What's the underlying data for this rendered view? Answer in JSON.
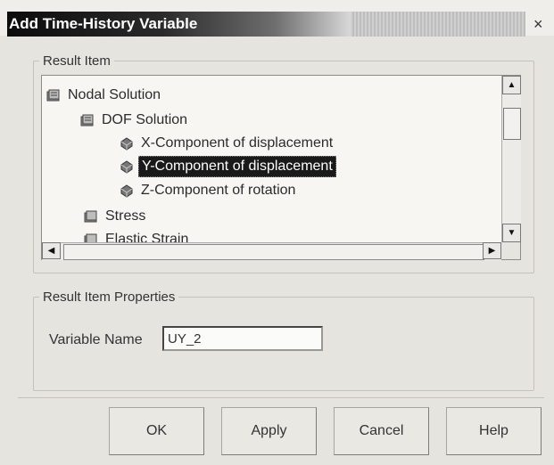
{
  "window": {
    "title": "Add Time-History Variable",
    "close_glyph": "×"
  },
  "result_item": {
    "legend": "Result Item",
    "tree": [
      {
        "label": "Nodal Solution",
        "icon": "folder-icon",
        "selected": false
      },
      {
        "label": "DOF Solution",
        "icon": "folder-icon",
        "selected": false
      },
      {
        "label": "X-Component of displacement",
        "icon": "item-icon",
        "selected": false
      },
      {
        "label": "Y-Component of displacement",
        "icon": "item-icon",
        "selected": true
      },
      {
        "label": "Z-Component of rotation",
        "icon": "item-icon",
        "selected": false
      },
      {
        "label": "Stress",
        "icon": "folder-icon",
        "selected": false
      },
      {
        "label": "Elastic Strain",
        "icon": "folder-icon",
        "selected": false
      }
    ]
  },
  "properties": {
    "legend": "Result Item Properties",
    "variable_name_label": "Variable Name",
    "variable_name_value": "UY_2"
  },
  "buttons": {
    "ok": "OK",
    "apply": "Apply",
    "cancel": "Cancel",
    "help": "Help"
  },
  "colors": {
    "selection": "#1a1a1a",
    "title_bar": "#0c0c0c"
  }
}
